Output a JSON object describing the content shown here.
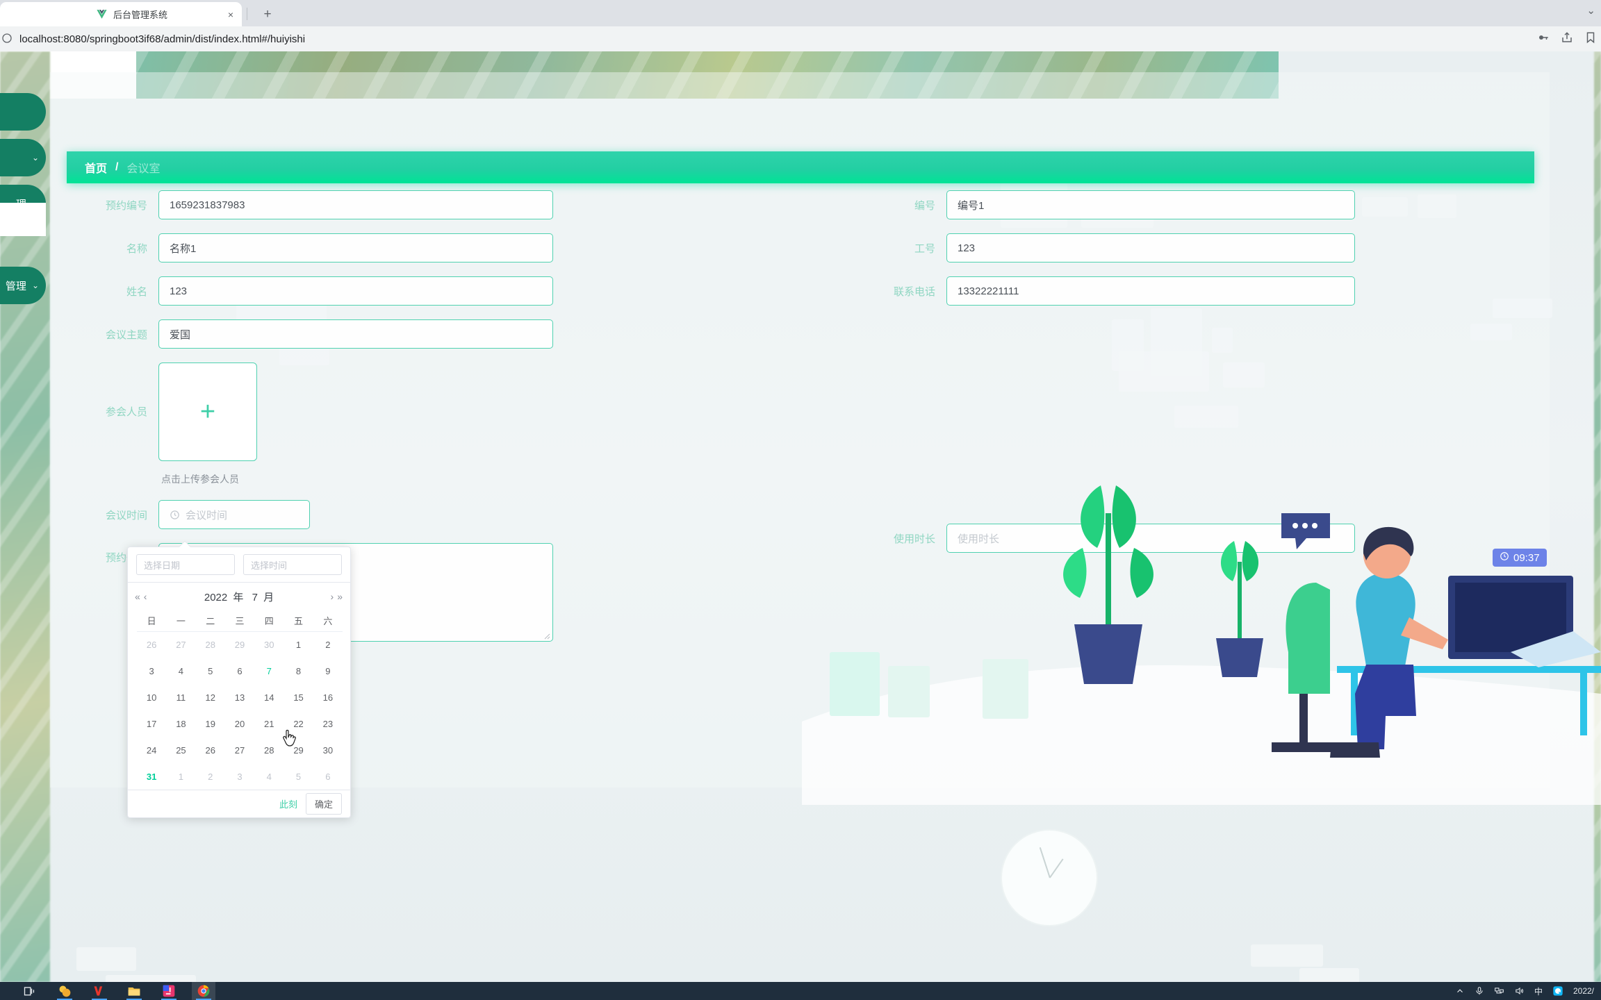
{
  "browser": {
    "tabs": [
      {
        "title": "",
        "favicon": "none",
        "close_label": "×"
      },
      {
        "title": "后台管理系统",
        "favicon": "vue-icon",
        "close_label": "×"
      }
    ],
    "new_tab_label": "+",
    "window_controls": "⌄",
    "url": "localhost:8080/springboot3if68/admin/dist/index.html#/huiyishi",
    "site_info_icon": "info-icon",
    "omni_icons": [
      "key-icon",
      "share-icon",
      "bookmark-icon"
    ]
  },
  "sidebar": {
    "items": [
      {
        "label": "",
        "chevron": ""
      },
      {
        "label": "",
        "chevron": "⌄"
      },
      {
        "label": "理",
        "chevron": "⌄"
      },
      {
        "label": "管理",
        "chevron": "⌄"
      }
    ]
  },
  "breadcrumb": {
    "home": "首页",
    "separator": "/",
    "current": "会议室"
  },
  "form": {
    "left": [
      {
        "label": "预约编号",
        "value": "1659231837983",
        "placeholder": "预约编号",
        "empty": false
      },
      {
        "label": "名称",
        "value": "名称1",
        "placeholder": "名称",
        "empty": false
      },
      {
        "label": "姓名",
        "value": "123",
        "placeholder": "姓名",
        "empty": false
      },
      {
        "label": "会议主题",
        "value": "爱国",
        "placeholder": "会议主题",
        "empty": false
      }
    ],
    "right": [
      {
        "label": "编号",
        "value": "编号1",
        "placeholder": "编号",
        "empty": false
      },
      {
        "label": "工号",
        "value": "123",
        "placeholder": "工号",
        "empty": false
      },
      {
        "label": "联系电话",
        "value": "13322221111",
        "placeholder": "联系电话",
        "empty": false
      }
    ],
    "upload": {
      "label": "参会人员",
      "plus": "+",
      "tip": "点击上传参会人员"
    },
    "meeting_time": {
      "label": "会议时间",
      "placeholder": "会议时间",
      "value": "",
      "icon": "clock-icon"
    },
    "duration": {
      "label": "使用时长",
      "placeholder": "使用时长",
      "value": ""
    },
    "remark": {
      "label": "预约备注",
      "placeholder": "",
      "value": ""
    }
  },
  "datepicker": {
    "date_editor_placeholder": "选择日期",
    "time_editor_placeholder": "选择时间",
    "date_editor_value": "",
    "time_editor_value": "",
    "prev_year": "«",
    "prev_month": "‹",
    "next_month": "›",
    "next_year": "»",
    "year": "2022",
    "year_unit": "年",
    "month": "7",
    "month_unit": "月",
    "weekdays": [
      "日",
      "一",
      "二",
      "三",
      "四",
      "五",
      "六"
    ],
    "weeks": [
      [
        {
          "d": "26",
          "type": "other"
        },
        {
          "d": "27",
          "type": "other"
        },
        {
          "d": "28",
          "type": "other"
        },
        {
          "d": "29",
          "type": "other"
        },
        {
          "d": "30",
          "type": "other"
        },
        {
          "d": "1",
          "type": "normal"
        },
        {
          "d": "2",
          "type": "normal"
        }
      ],
      [
        {
          "d": "3",
          "type": "normal"
        },
        {
          "d": "4",
          "type": "normal"
        },
        {
          "d": "5",
          "type": "normal"
        },
        {
          "d": "6",
          "type": "normal"
        },
        {
          "d": "7",
          "type": "cur-green"
        },
        {
          "d": "8",
          "type": "normal"
        },
        {
          "d": "9",
          "type": "normal"
        }
      ],
      [
        {
          "d": "10",
          "type": "normal"
        },
        {
          "d": "11",
          "type": "normal"
        },
        {
          "d": "12",
          "type": "normal"
        },
        {
          "d": "13",
          "type": "normal"
        },
        {
          "d": "14",
          "type": "normal"
        },
        {
          "d": "15",
          "type": "normal"
        },
        {
          "d": "16",
          "type": "normal"
        }
      ],
      [
        {
          "d": "17",
          "type": "normal"
        },
        {
          "d": "18",
          "type": "normal"
        },
        {
          "d": "19",
          "type": "normal"
        },
        {
          "d": "20",
          "type": "normal"
        },
        {
          "d": "21",
          "type": "normal"
        },
        {
          "d": "22",
          "type": "normal"
        },
        {
          "d": "23",
          "type": "normal"
        }
      ],
      [
        {
          "d": "24",
          "type": "normal"
        },
        {
          "d": "25",
          "type": "normal"
        },
        {
          "d": "26",
          "type": "normal"
        },
        {
          "d": "27",
          "type": "normal"
        },
        {
          "d": "28",
          "type": "normal"
        },
        {
          "d": "29",
          "type": "normal"
        },
        {
          "d": "30",
          "type": "normal"
        }
      ],
      [
        {
          "d": "31",
          "type": "today"
        },
        {
          "d": "1",
          "type": "other"
        },
        {
          "d": "2",
          "type": "other"
        },
        {
          "d": "3",
          "type": "other"
        },
        {
          "d": "4",
          "type": "other"
        },
        {
          "d": "5",
          "type": "other"
        },
        {
          "d": "6",
          "type": "other"
        }
      ]
    ],
    "now_label": "此刻",
    "confirm_label": "确定"
  },
  "illustration": {
    "time_badge": "09:37",
    "time_badge_icon": "clock-icon"
  },
  "taskbar": {
    "icons": [
      "task-view-icon",
      "app-orange-icon",
      "wps-icon",
      "file-explorer-icon",
      "intellij-icon",
      "chrome-icon"
    ],
    "tray": [
      "chevron-up-icon",
      "microphone-icon",
      "network-icon",
      "volume-icon",
      "ime-cn-icon",
      "qq-icon"
    ],
    "ime_label": "中",
    "date": "2022/"
  },
  "colors": {
    "accent_green": "#00cf9a",
    "header_green": "#23cfa3",
    "sidebar_green": "#147f63",
    "label_green": "#8fd6c2",
    "badge_blue": "#6d83e8"
  }
}
